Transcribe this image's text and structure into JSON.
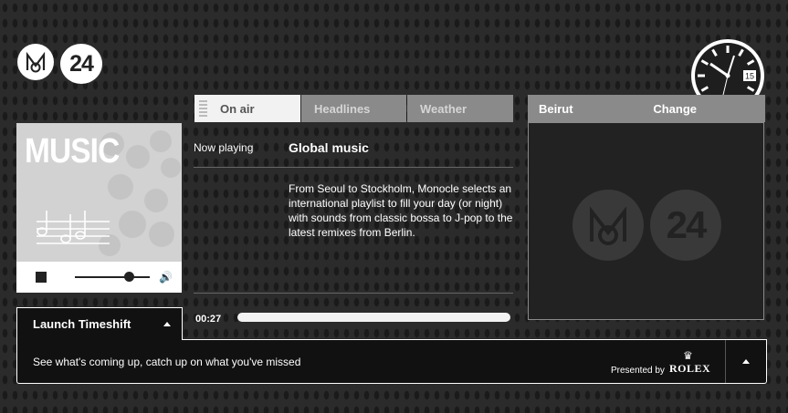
{
  "header": {
    "logo_24": "24"
  },
  "tabs": [
    {
      "label": "On air",
      "active": true
    },
    {
      "label": "Headlines",
      "active": false
    },
    {
      "label": "Weather",
      "active": false
    }
  ],
  "city_panel": {
    "city": "Beirut",
    "change_label": "Change",
    "watermark_24": "24"
  },
  "music_card": {
    "title": "MUSIC",
    "volume_level": 0.72
  },
  "now_playing": {
    "label": "Now playing",
    "title": "Global music",
    "description": "From Seoul to Stockholm, Monocle selects an international playlist to fill your day (or night) with sounds from classic bossa to J-pop to the latest remixes from Berlin.",
    "elapsed": "00:27"
  },
  "timeshift": {
    "launch_label": "Launch Timeshift",
    "description": "See what's coming up, catch up on what you've missed",
    "presented_by": "Presented by",
    "sponsor": "ROLEX"
  },
  "watch": {
    "date": "15"
  },
  "icons": {
    "stop": "stop-icon",
    "speaker": "speaker-icon",
    "chevron_up": "chevron-up-icon",
    "crown": "crown-icon"
  },
  "colors": {
    "tab_active_bg": "#f2f2f2",
    "tab_inactive_bg": "#8a8a8a",
    "panel_bg": "#222222"
  }
}
